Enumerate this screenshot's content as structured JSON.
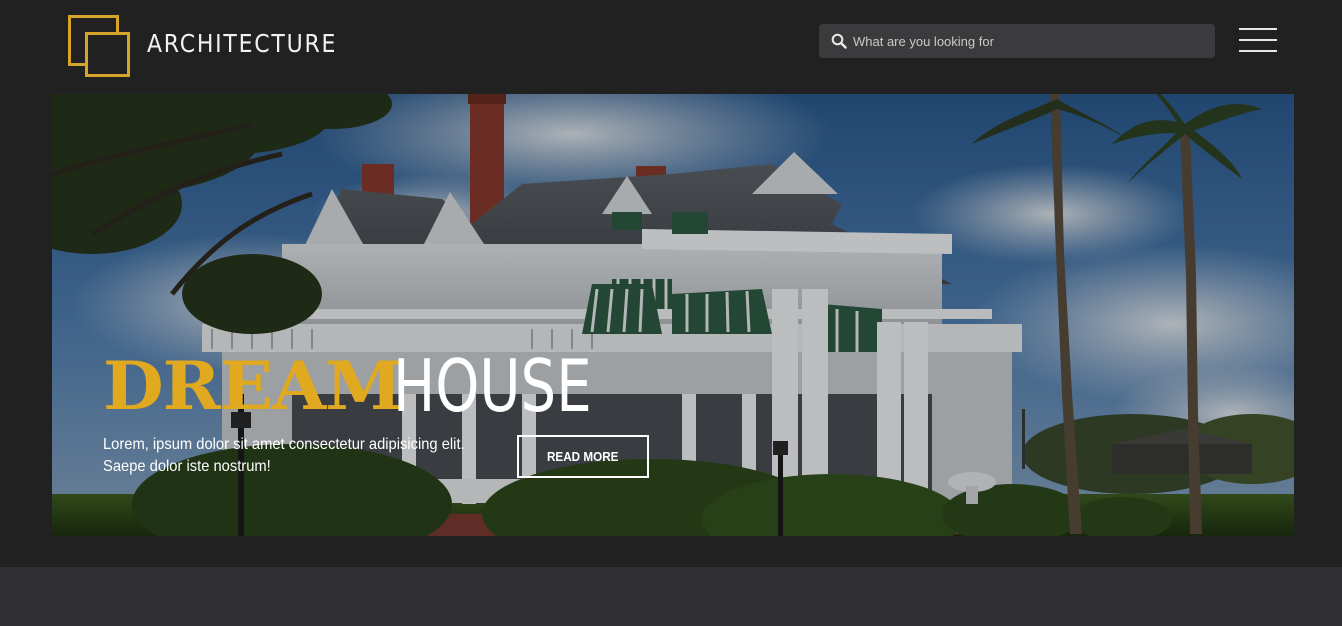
{
  "header": {
    "logo_text": "ARCHITECTURE",
    "search_placeholder": "What are you looking for",
    "search_value": "",
    "menu_icon": "hamburger-icon",
    "search_icon": "search-icon"
  },
  "hero": {
    "title_accent": "DREAM",
    "title_main": "HOUSE",
    "description_line1": "Lorem, ipsum dolor sit amet consectetur adipisicing elit.",
    "description_line2": "Saepe dolor iste nostrum!",
    "cta_label": "READ MORE"
  },
  "colors": {
    "accent": "#d4a52a",
    "header_bg": "#212121",
    "footer_bg": "#2f2f31",
    "search_bg": "#3b3b3d"
  }
}
